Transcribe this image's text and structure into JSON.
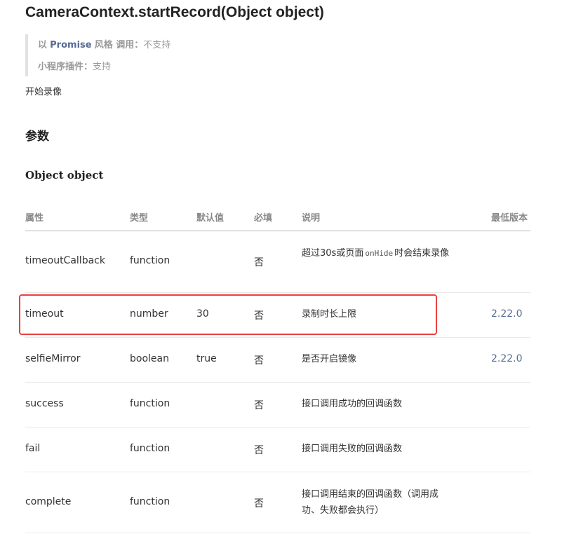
{
  "doc": {
    "title": "CameraContext.startRecord(Object object)",
    "callout": {
      "prefix": "以",
      "promise": "Promise",
      "style_call": "风格 调用：",
      "promise_value": "不支持",
      "plugin_label": "小程序插件：",
      "plugin_value": "支持"
    },
    "description": "开始录像",
    "params_heading": "参数",
    "object_heading": "Object object"
  },
  "table": {
    "headers": [
      "属性",
      "类型",
      "默认值",
      "必填",
      "说明",
      "最低版本"
    ],
    "rows": [
      {
        "name": "timeoutCallback",
        "type": "function",
        "default": "",
        "required": "否",
        "desc_pre": "超过30s或页面",
        "desc_code": "onHide",
        "desc_post": "时会结束录像",
        "version": ""
      },
      {
        "name": "timeout",
        "type": "number",
        "default": "30",
        "required": "否",
        "desc_pre": "录制时长上限",
        "version": "2.22.0"
      },
      {
        "name": "selfieMirror",
        "type": "boolean",
        "default": "true",
        "required": "否",
        "desc_pre": "是否开启镜像",
        "version": "2.22.0"
      },
      {
        "name": "success",
        "type": "function",
        "default": "",
        "required": "否",
        "desc_pre": "接口调用成功的回调函数",
        "version": ""
      },
      {
        "name": "fail",
        "type": "function",
        "default": "",
        "required": "否",
        "desc_pre": "接口调用失败的回调函数",
        "version": ""
      },
      {
        "name": "complete",
        "type": "function",
        "default": "",
        "required": "否",
        "desc_pre": "接口调用结束的回调函数（调用成功、失败都会执行）",
        "version": ""
      }
    ]
  },
  "colors": {
    "link": "#576b95",
    "highlight_border": "#e8423f",
    "header_rule": "#b8b8b8",
    "row_rule": "#e8e8e8"
  }
}
